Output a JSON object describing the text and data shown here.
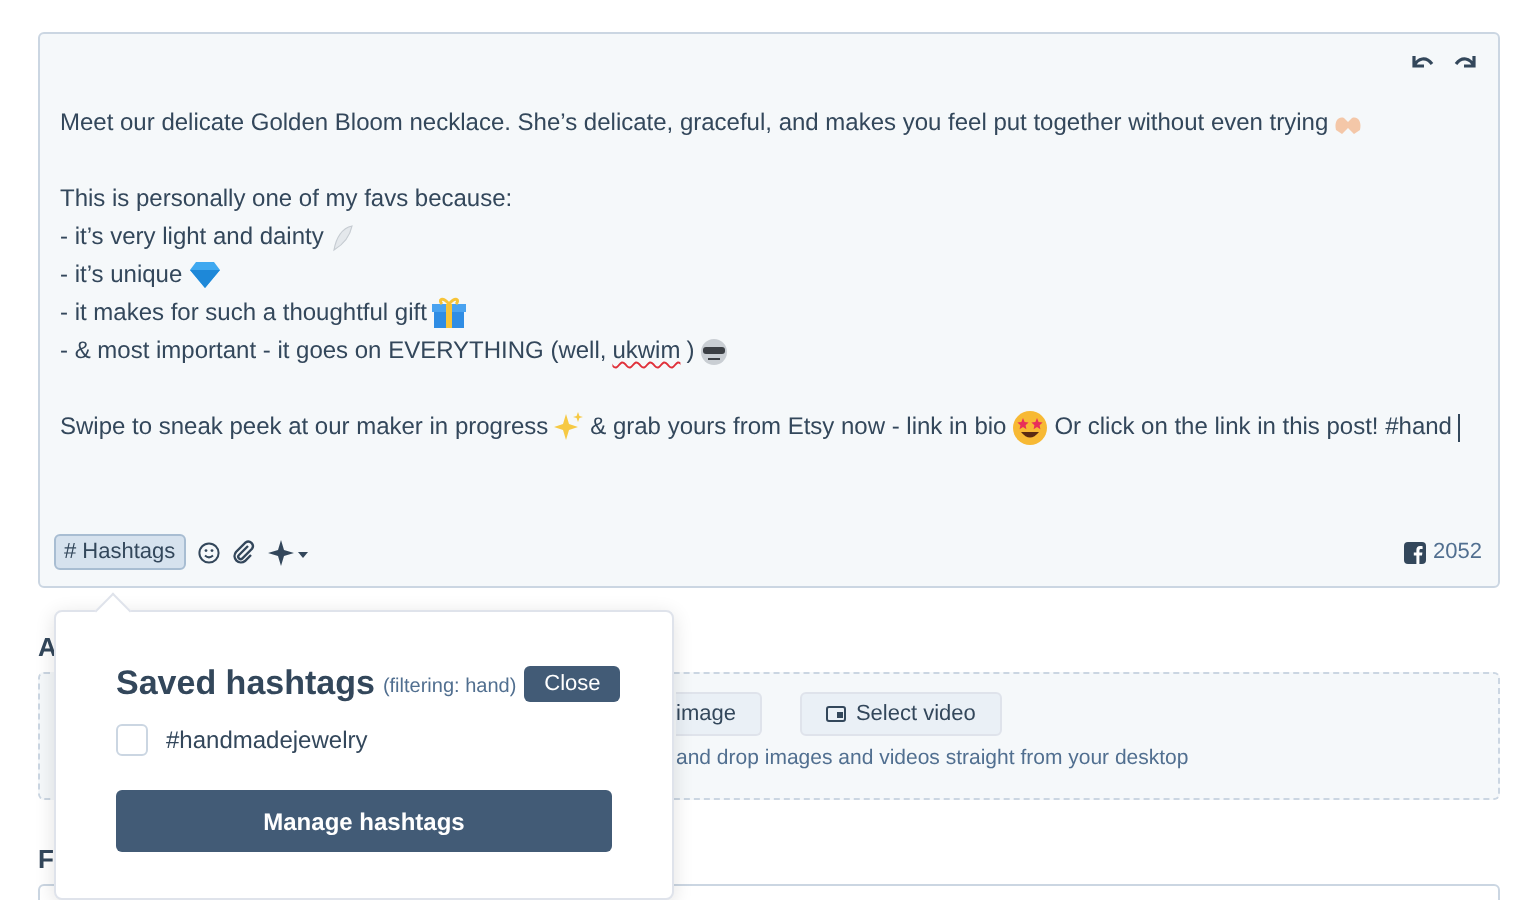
{
  "post": {
    "paragraphs": [
      [
        [
          {
            "kind": "text",
            "text": "Meet our delicate Golden Bloom necklace. She’s delicate, graceful, and makes you feel put together without even trying"
          },
          {
            "kind": "emoji"
          }
        ]
      ],
      [
        [
          {
            "kind": "text",
            "text": "This is personally one of my favs because:"
          }
        ],
        [
          {
            "kind": "text",
            "text": "- it’s very light and dainty"
          },
          {
            "kind": "emoji"
          }
        ],
        [
          {
            "kind": "text",
            "text": "- it’s unique"
          },
          {
            "kind": "emoji"
          }
        ],
        [
          {
            "kind": "text",
            "text": "- it makes for such a thoughtful gift"
          },
          {
            "kind": "emoji"
          }
        ],
        [
          {
            "kind": "text",
            "text": "- & most important - it goes on EVERYTHING (well, "
          },
          {
            "kind": "text",
            "text": "ukwim",
            "misspelled": true
          },
          {
            "kind": "text",
            "text": ")"
          },
          {
            "kind": "emoji"
          }
        ]
      ],
      [
        [
          {
            "kind": "text",
            "text": "Swipe to sneak peek at our maker in progress"
          },
          {
            "kind": "emoji"
          },
          {
            "kind": "text",
            "text": "& grab yours from Etsy now - link in bio"
          },
          {
            "kind": "emoji"
          },
          {
            "kind": "text",
            "text": "Or click on the link in this post! #hand"
          },
          {
            "kind": "caret"
          }
        ]
      ]
    ],
    "toolbar": {
      "hashtags_button": {
        "label": "# Hashtags",
        "selected": true
      }
    },
    "character_count": "2052"
  },
  "attachments": {
    "label": "A",
    "buttons": [
      "image",
      "Select video"
    ],
    "hint": "and drop images and videos straight from your desktop"
  },
  "next_section": {
    "label": "F"
  },
  "hashtag_popover": {
    "title": "Saved hashtags",
    "filter": "(filtering: hand)",
    "close": "Close",
    "items": [
      {
        "label": "#handmadejewelry",
        "checked": false
      }
    ],
    "manage": "Manage hashtags"
  }
}
